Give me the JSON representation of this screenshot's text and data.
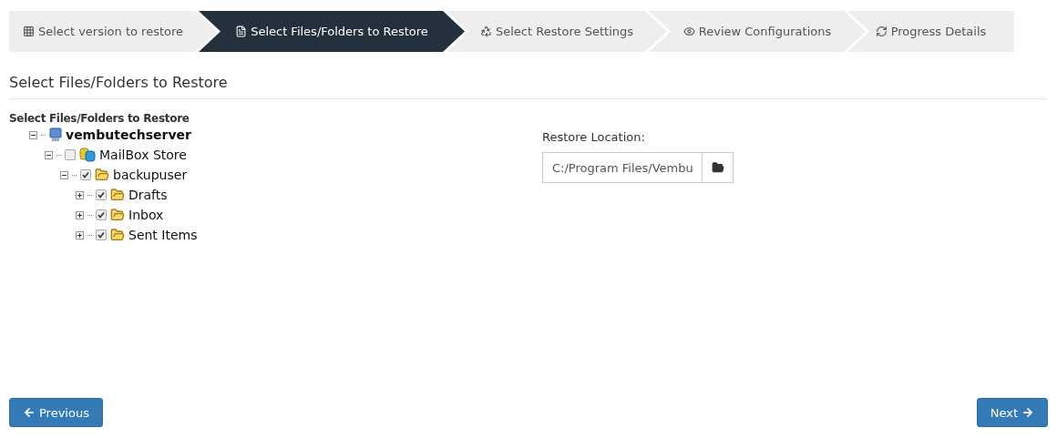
{
  "steps": [
    {
      "label": "Select version to restore",
      "selected": false
    },
    {
      "label": "Select Files/Folders to Restore",
      "selected": true
    },
    {
      "label": "Select Restore Settings",
      "selected": false
    },
    {
      "label": "Review Configurations",
      "selected": false
    },
    {
      "label": "Progress Details",
      "selected": false
    }
  ],
  "page_title": "Select Files/Folders to Restore",
  "tree": {
    "label": "Select Files/Folders to Restore",
    "nodes": [
      {
        "kind": "server",
        "label": "vembutechserver",
        "expanded": true,
        "children": [
          {
            "kind": "database",
            "label": "MailBox Store",
            "expanded": true,
            "checked": false,
            "children": [
              {
                "kind": "folder",
                "label": "backupuser",
                "expanded": true,
                "checked": true,
                "children": [
                  {
                    "kind": "folder",
                    "label": "Drafts",
                    "expanded": false,
                    "checked": true
                  },
                  {
                    "kind": "folder",
                    "label": "Inbox",
                    "expanded": false,
                    "checked": true
                  },
                  {
                    "kind": "folder",
                    "label": "Sent Items",
                    "expanded": false,
                    "checked": true
                  }
                ]
              }
            ]
          }
        ]
      }
    ]
  },
  "restore_location": {
    "label": "Restore Location:",
    "value": "C:/Program Files/Vembu"
  },
  "buttons": {
    "previous": "Previous",
    "next": "Next"
  }
}
